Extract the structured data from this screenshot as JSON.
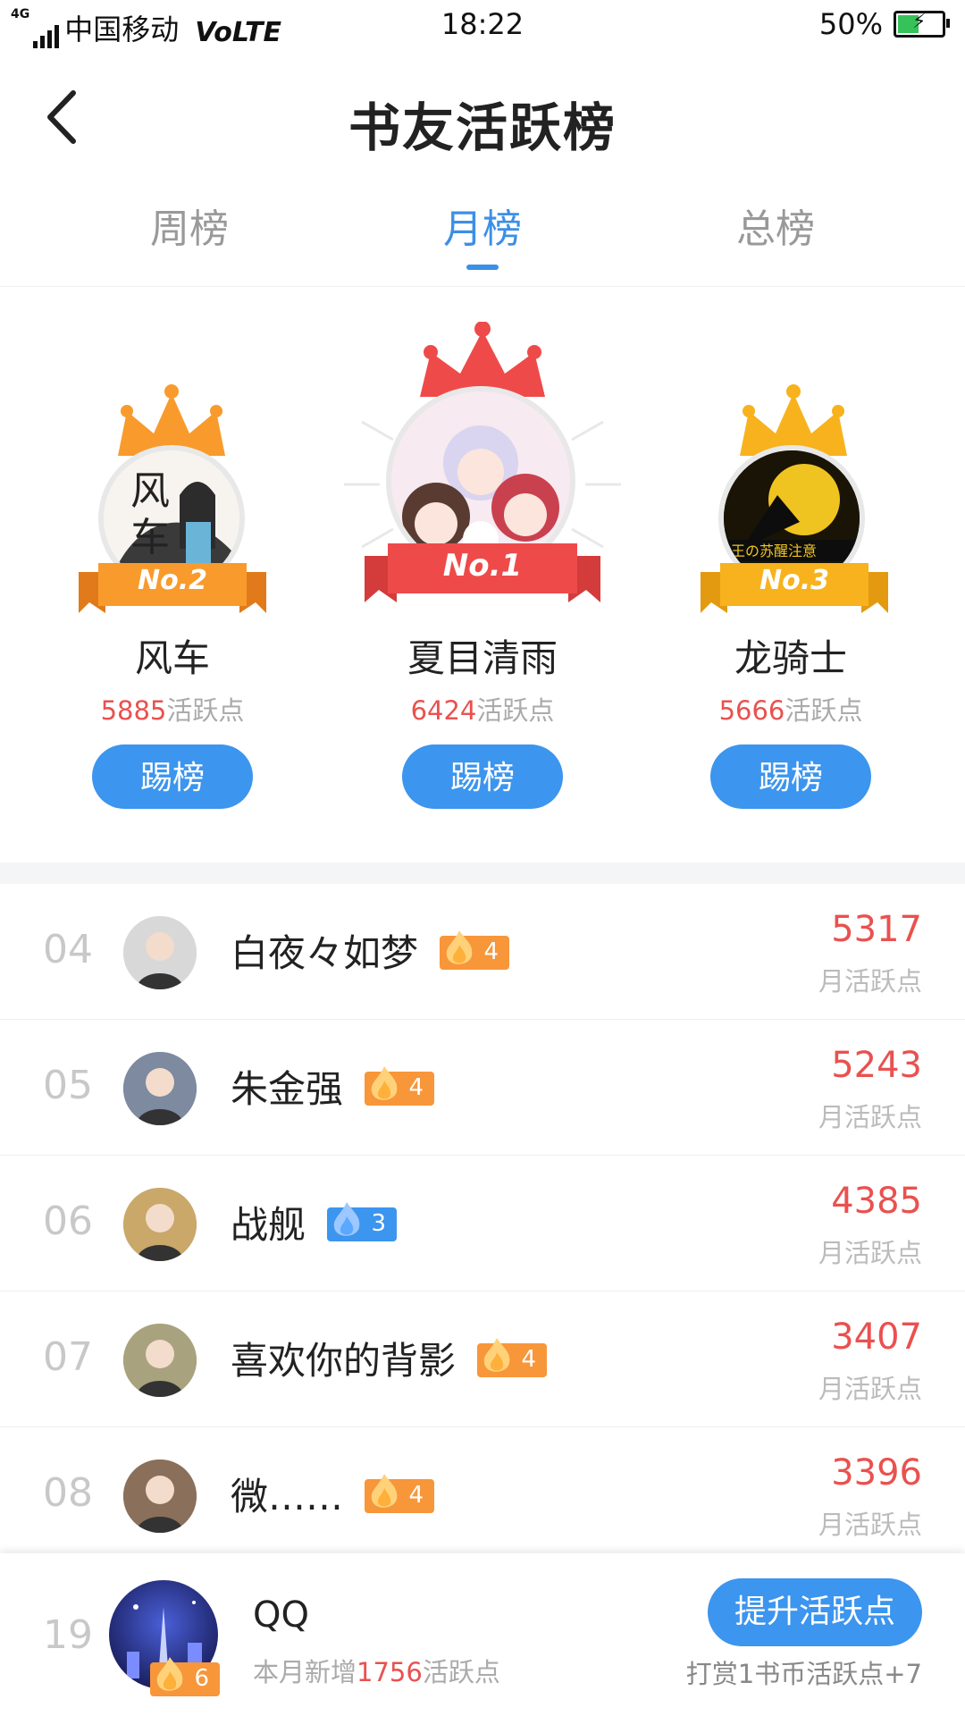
{
  "status_bar": {
    "network": "4G",
    "carrier": "中国移动",
    "volte": "VoLTE",
    "time": "18:22",
    "battery": "50%",
    "battery_level": 0.5
  },
  "header": {
    "title": "书友活跃榜",
    "back_icon": "chevron-left-icon"
  },
  "tabs": [
    {
      "label": "周榜",
      "active": false
    },
    {
      "label": "月榜",
      "active": true
    },
    {
      "label": "总榜",
      "active": false
    }
  ],
  "podium": [
    {
      "rank_label": "No.2",
      "name": "风车",
      "points": "5885",
      "points_suffix": "活跃点",
      "button": "踢榜",
      "crown_color": "#f89b2c",
      "ribbon_color": "#f89b2c"
    },
    {
      "rank_label": "No.1",
      "name": "夏目清雨",
      "points": "6424",
      "points_suffix": "活跃点",
      "button": "踢榜",
      "crown_color": "#ef4a4a",
      "ribbon_color": "#ef4a4a"
    },
    {
      "rank_label": "No.3",
      "name": "龙骑士",
      "points": "5666",
      "points_suffix": "活跃点",
      "button": "踢榜",
      "crown_color": "#f7b21d",
      "ribbon_color": "#f7b21d"
    }
  ],
  "list": [
    {
      "rank": "04",
      "name": "白夜々如梦",
      "level": "4",
      "level_color": "#f8963a",
      "score": "5317",
      "score_label": "月活跃点",
      "avatar_color": "#d8d8d8"
    },
    {
      "rank": "05",
      "name": "朱金强",
      "level": "4",
      "level_color": "#f8963a",
      "score": "5243",
      "score_label": "月活跃点",
      "avatar_color": "#7d8aa0"
    },
    {
      "rank": "06",
      "name": "战舰",
      "level": "3",
      "level_color": "#3c95ee",
      "score": "4385",
      "score_label": "月活跃点",
      "avatar_color": "#c9a86a"
    },
    {
      "rank": "07",
      "name": "喜欢你的背影",
      "level": "4",
      "level_color": "#f8963a",
      "score": "3407",
      "score_label": "月活跃点",
      "avatar_color": "#a8a27e"
    },
    {
      "rank": "08",
      "name": "微……",
      "level": "4",
      "level_color": "#f8963a",
      "score": "3396",
      "score_label": "月活跃点",
      "avatar_color": "#8a6f5a"
    }
  ],
  "self": {
    "rank": "19",
    "name": "QQ",
    "level": "6",
    "gain_prefix": "本月新增",
    "gain_value": "1756",
    "gain_suffix": "活跃点",
    "button": "提升活跃点",
    "tip": "打赏1书币活跃点+7"
  }
}
